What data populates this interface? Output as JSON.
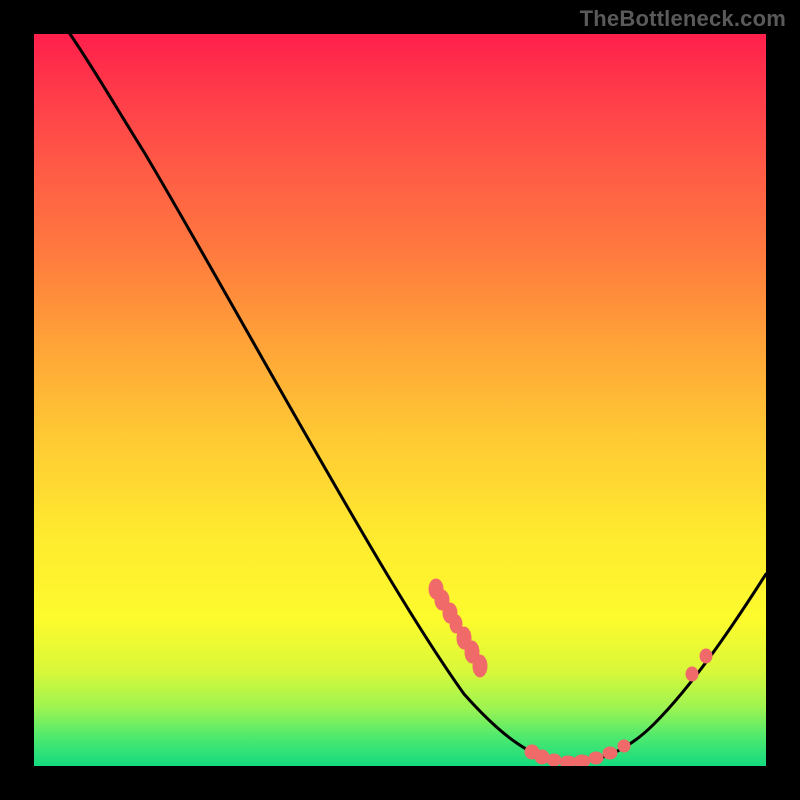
{
  "watermark": "TheBottleneck.com",
  "chart_data": {
    "type": "line",
    "title": "",
    "xlabel": "",
    "ylabel": "",
    "xlim": [
      0,
      100
    ],
    "ylim": [
      0,
      100
    ],
    "x": [
      5,
      8,
      12,
      16,
      20,
      25,
      30,
      35,
      40,
      45,
      50,
      55,
      60,
      62,
      65,
      68,
      70,
      73,
      76,
      80,
      84,
      88,
      92,
      96,
      100
    ],
    "values": [
      100,
      96,
      92,
      87,
      82,
      75,
      67,
      59,
      51,
      43,
      35,
      27,
      18,
      13,
      7,
      3,
      1,
      0,
      0,
      2,
      6,
      12,
      19,
      26,
      34
    ],
    "flat_minimum_range": [
      70,
      78
    ],
    "marker_points_x": [
      55,
      56,
      58,
      59,
      60,
      61,
      69,
      72,
      73,
      76,
      78,
      80,
      90,
      92
    ],
    "marker_color": "#f06a6a",
    "curve_color": "#000000",
    "background_gradient": [
      "#ff1f4b",
      "#ffe92f",
      "#14db7f"
    ]
  }
}
